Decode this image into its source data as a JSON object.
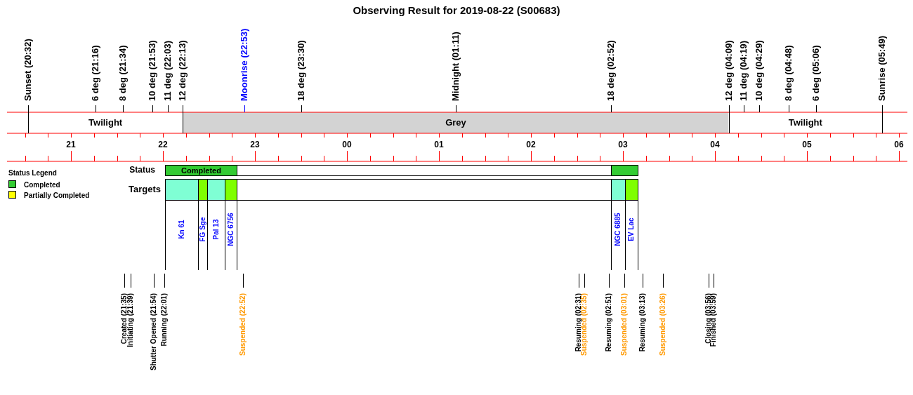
{
  "title": "Observing Result for 2019-08-22 (S00683)",
  "sky_events": [
    {
      "label": "Sunset (20:32)",
      "kind": "boundary",
      "color": "#000000"
    },
    {
      "label": "6 deg (21:16)",
      "kind": "tick",
      "color": "#000000"
    },
    {
      "label": "8 deg (21:34)",
      "kind": "tick",
      "color": "#000000"
    },
    {
      "label": "10 deg (21:53)",
      "kind": "tick",
      "color": "#000000"
    },
    {
      "label": "11 deg (22:03)",
      "kind": "tick",
      "color": "#000000"
    },
    {
      "label": "12 deg (22:13)",
      "kind": "boundary",
      "color": "#000000"
    },
    {
      "label": "Moonrise (22:53)",
      "kind": "tick",
      "color": "#0000ff"
    },
    {
      "label": "18 deg (23:30)",
      "kind": "tick",
      "color": "#000000"
    },
    {
      "label": "Midnight (01:11)",
      "kind": "tick",
      "color": "#000000"
    },
    {
      "label": "18 deg (02:52)",
      "kind": "tick",
      "color": "#000000"
    },
    {
      "label": "12 deg (04:09)",
      "kind": "boundary",
      "color": "#000000"
    },
    {
      "label": "11 deg (04:19)",
      "kind": "tick",
      "color": "#000000"
    },
    {
      "label": "10 deg (04:29)",
      "kind": "tick",
      "color": "#000000"
    },
    {
      "label": "8 deg (04:48)",
      "kind": "tick",
      "color": "#000000"
    },
    {
      "label": "6 deg (05:06)",
      "kind": "tick",
      "color": "#000000"
    },
    {
      "label": "Sunrise (05:49)",
      "kind": "boundary",
      "color": "#000000"
    }
  ],
  "bands": [
    {
      "label": "Twilight",
      "kind": "twilight"
    },
    {
      "label": "Grey",
      "kind": "grey"
    },
    {
      "label": "Twilight",
      "kind": "twilight"
    }
  ],
  "hour_labels": [
    {
      "label": "21"
    },
    {
      "label": "22"
    },
    {
      "label": "23"
    },
    {
      "label": "00"
    },
    {
      "label": "01"
    },
    {
      "label": "02"
    },
    {
      "label": "03"
    },
    {
      "label": "04"
    },
    {
      "label": "05"
    },
    {
      "label": "06"
    }
  ],
  "status_legend": {
    "title": "Status Legend",
    "items": [
      {
        "label": "Completed",
        "color": "#33cc33"
      },
      {
        "label": "Partially Completed",
        "color": "#ffff00"
      }
    ]
  },
  "status": {
    "label": "Status",
    "segments": [
      {
        "label": "Completed",
        "color": "#33cc33"
      },
      {
        "color": "#33cc33"
      }
    ]
  },
  "targets": {
    "label": "Targets",
    "items": [
      {
        "name": "Kn 61",
        "color": "#7fffd4"
      },
      {
        "name": "FG Sge",
        "color": "#7fff00"
      },
      {
        "name": "Pal 13",
        "color": "#7fffd4"
      },
      {
        "name": "NGC 6756",
        "color": "#7fff00"
      },
      {
        "name": "NGC 6885",
        "color": "#7fffd4"
      },
      {
        "name": "EV Lac",
        "color": "#7fff00"
      }
    ]
  },
  "state_changes": [
    {
      "label": "Created (21:35)",
      "color": "#000000"
    },
    {
      "label": "Initiating (21:39)",
      "color": "#000000"
    },
    {
      "label": "Shutter Opened (21:54)",
      "color": "#000000"
    },
    {
      "label": "Running (22:01)",
      "color": "#000000"
    },
    {
      "label": "Suspended (22:52)",
      "color": "#ff9900"
    },
    {
      "label": "Resuming (02:31)",
      "color": "#000000"
    },
    {
      "label": "Suspended (02:35)",
      "color": "#ff9900"
    },
    {
      "label": "Resuming (02:51)",
      "color": "#000000"
    },
    {
      "label": "Suspended (03:01)",
      "color": "#ff9900"
    },
    {
      "label": "Resuming (03:13)",
      "color": "#000000"
    },
    {
      "label": "Suspended (03:26)",
      "color": "#ff9900"
    },
    {
      "label": "Closing (03:56)",
      "color": "#000000"
    },
    {
      "label": "Finished (03:59)",
      "color": "#000000"
    }
  ]
}
